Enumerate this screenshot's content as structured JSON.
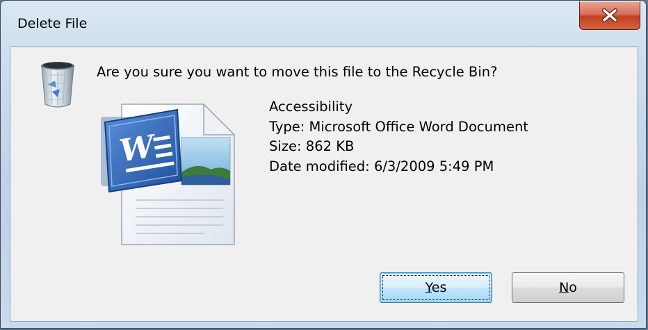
{
  "window": {
    "title": "Delete File",
    "close_glyph": "x"
  },
  "dialog": {
    "question": "Are you sure you want to move this file to the Recycle Bin?",
    "icons": {
      "recycle_bin": "recycle-bin-icon",
      "document": "word-document-icon"
    }
  },
  "file": {
    "name": "Accessibility",
    "type": "Type: Microsoft Office Word Document",
    "size": "Size: 862 KB",
    "date_modified": "Date modified: 6/3/2009 5:49 PM"
  },
  "buttons": {
    "yes": {
      "mnemonic": "Y",
      "rest": "es"
    },
    "no": {
      "mnemonic": "N",
      "rest": "o"
    }
  },
  "colors": {
    "close_button": "#c23f21",
    "default_button_border": "#3c7fb1",
    "word_blue": "#2a5db0"
  }
}
